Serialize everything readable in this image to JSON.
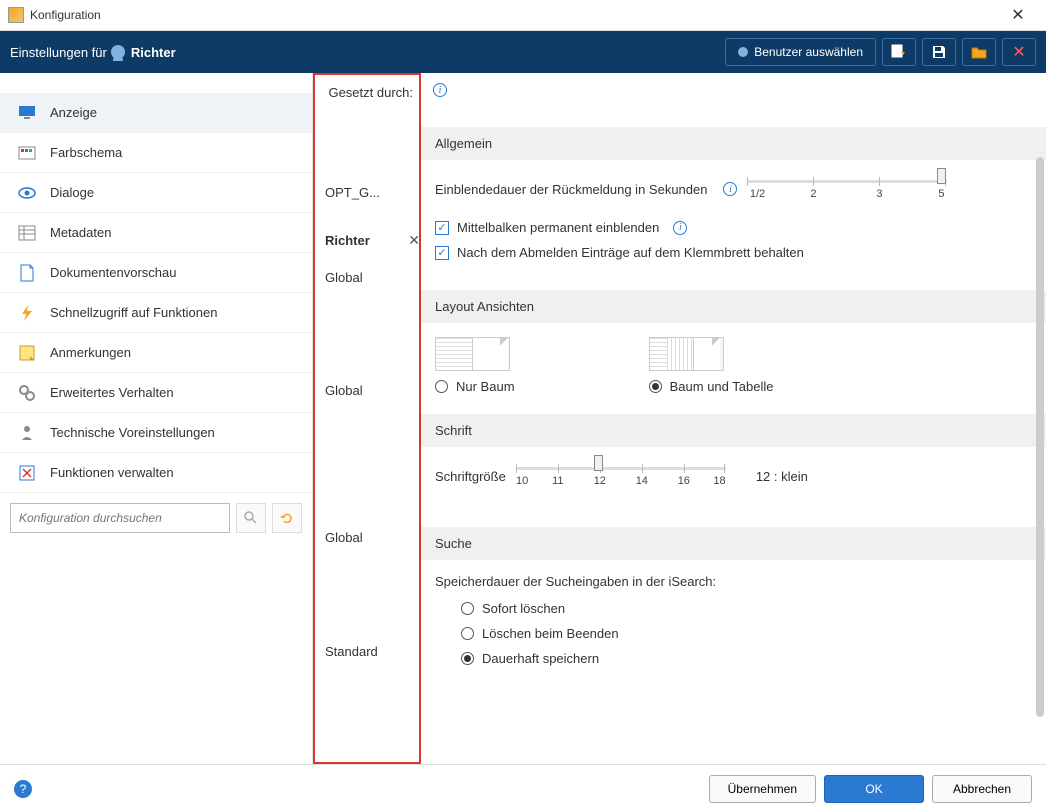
{
  "window": {
    "title": "Konfiguration"
  },
  "header": {
    "settings_for": "Einstellungen für",
    "username": "Richter",
    "select_user_btn": "Benutzer auswählen"
  },
  "sidebar": {
    "items": [
      {
        "label": "Anzeige",
        "icon": "monitor",
        "selected": true
      },
      {
        "label": "Farbschema",
        "icon": "palette"
      },
      {
        "label": "Dialoge",
        "icon": "eye"
      },
      {
        "label": "Metadaten",
        "icon": "table"
      },
      {
        "label": "Dokumentenvorschau",
        "icon": "document"
      },
      {
        "label": "Schnellzugriff auf Funktionen",
        "icon": "bolt"
      },
      {
        "label": "Anmerkungen",
        "icon": "note"
      },
      {
        "label": "Erweitertes Verhalten",
        "icon": "gears"
      },
      {
        "label": "Technische Voreinstellungen",
        "icon": "wrench-user"
      },
      {
        "label": "Funktionen verwalten",
        "icon": "manage"
      }
    ],
    "search_placeholder": "Konfiguration durchsuchen"
  },
  "middle": {
    "heading": "Gesetzt durch:",
    "scopes": {
      "opt": "OPT_G...",
      "richter": "Richter",
      "global1": "Global",
      "global2": "Global",
      "global3": "Global",
      "standard": "Standard"
    }
  },
  "content": {
    "sections": {
      "allgemein": {
        "title": "Allgemein",
        "einblend_label": "Einblendedauer der Rückmeldung in Sekunden",
        "slider": {
          "ticks": [
            "1/2",
            "2",
            "3",
            "5"
          ],
          "value": 5
        },
        "chk_mittelbalken": "Mittelbalken permanent einblenden",
        "chk_abmelden": "Nach dem Abmelden Einträge auf dem Klemmbrett behalten"
      },
      "layout": {
        "title": "Layout Ansichten",
        "opt_baum": "Nur Baum",
        "opt_baum_tabelle": "Baum und Tabelle"
      },
      "schrift": {
        "title": "Schrift",
        "label": "Schriftgröße",
        "ticks": [
          "10",
          "11",
          "12",
          "14",
          "16",
          "18"
        ],
        "current": "12 : klein"
      },
      "suche": {
        "title": "Suche",
        "label": "Speicherdauer der Sucheingaben in der iSearch:",
        "opt_sofort": "Sofort löschen",
        "opt_beenden": "Löschen beim Beenden",
        "opt_dauerhaft": "Dauerhaft speichern"
      }
    }
  },
  "bottom": {
    "apply": "Übernehmen",
    "ok": "OK",
    "cancel": "Abbrechen"
  }
}
